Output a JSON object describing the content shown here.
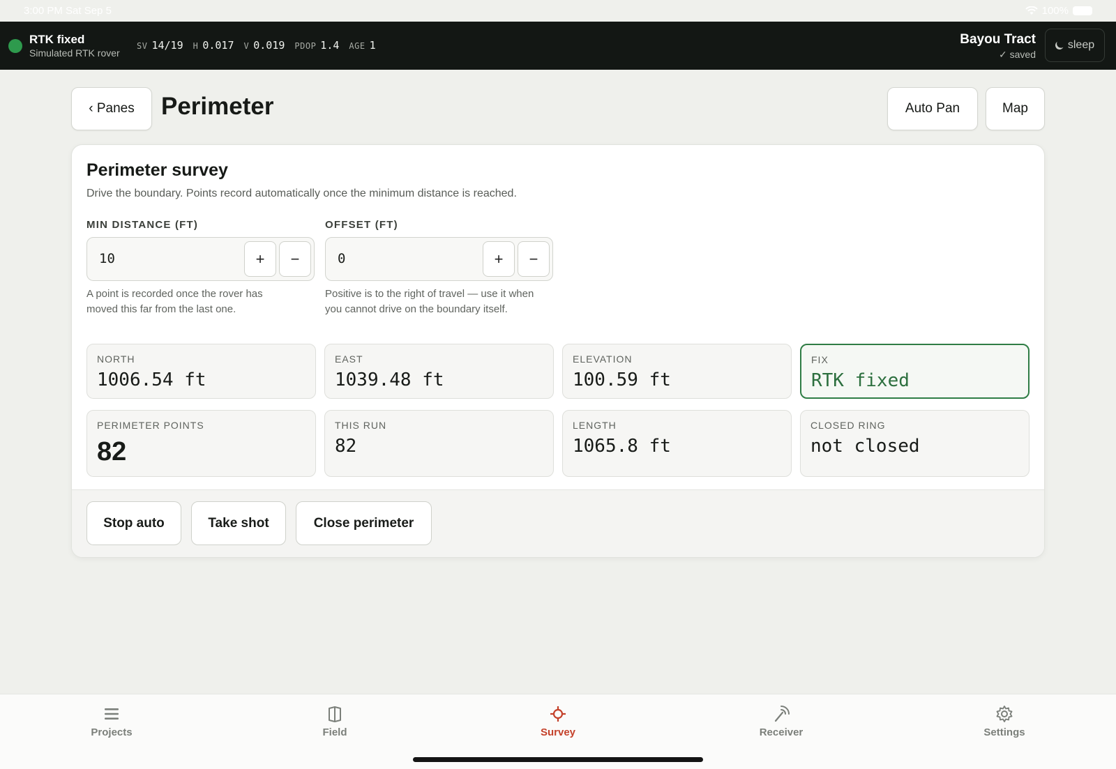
{
  "status_bar": {
    "time": "3:00 PM  Sat Sep 5",
    "battery": "100%"
  },
  "gnss": {
    "fix_title": "RTK fixed",
    "fix_subtitle": "Simulated RTK rover",
    "fix_color": "#2e9a4d",
    "metrics": [
      {
        "key": "SV",
        "value": "14/19"
      },
      {
        "key": "H",
        "value": "0.017"
      },
      {
        "key": "V",
        "value": "0.019"
      },
      {
        "key": "PDOP",
        "value": "1.4"
      },
      {
        "key": "AGE",
        "value": "1"
      }
    ],
    "project_name": "Bayou Tract",
    "project_status": "✓ saved",
    "sleep_label": "sleep"
  },
  "header": {
    "back_label": "‹ Panes",
    "title": "Perimeter",
    "auto_pan_label": "Auto Pan",
    "map_label": "Map"
  },
  "card": {
    "title": "Perimeter survey",
    "description": "Drive the boundary. Points record automatically once the minimum distance is reached.",
    "min_distance": {
      "label": "MIN DISTANCE (FT)",
      "value": "10",
      "plus": "+",
      "minus": "−",
      "help": "A point is recorded once the rover has moved this far from the last one."
    },
    "offset": {
      "label": "OFFSET (FT)",
      "value": "0",
      "plus": "+",
      "minus": "−",
      "help": "Positive is to the right of travel — use it when you cannot drive on the boundary itself."
    },
    "stats": [
      {
        "label": "NORTH",
        "value": "1006.54 ft"
      },
      {
        "label": "EAST",
        "value": "1039.48 ft"
      },
      {
        "label": "ELEVATION",
        "value": "100.59 ft"
      },
      {
        "label": "FIX",
        "value": "RTK fixed"
      },
      {
        "label": "PERIMETER POINTS",
        "value": "82"
      },
      {
        "label": "THIS RUN",
        "value": "82"
      },
      {
        "label": "LENGTH",
        "value": "1065.8 ft"
      },
      {
        "label": "CLOSED RING",
        "value": "not closed"
      }
    ],
    "actions": {
      "stop_auto": "Stop auto",
      "take_shot": "Take shot",
      "close_perimeter": "Close perimeter"
    }
  },
  "tabs": [
    {
      "label": "Projects",
      "icon": "list-icon"
    },
    {
      "label": "Field",
      "icon": "book-icon"
    },
    {
      "label": "Survey",
      "icon": "crosshair-icon",
      "active": true
    },
    {
      "label": "Receiver",
      "icon": "antenna-icon"
    },
    {
      "label": "Settings",
      "icon": "gear-icon"
    }
  ],
  "colors": {
    "accent": "#c4412a",
    "fix_green": "#2f7d45",
    "topbar": "#131714"
  }
}
